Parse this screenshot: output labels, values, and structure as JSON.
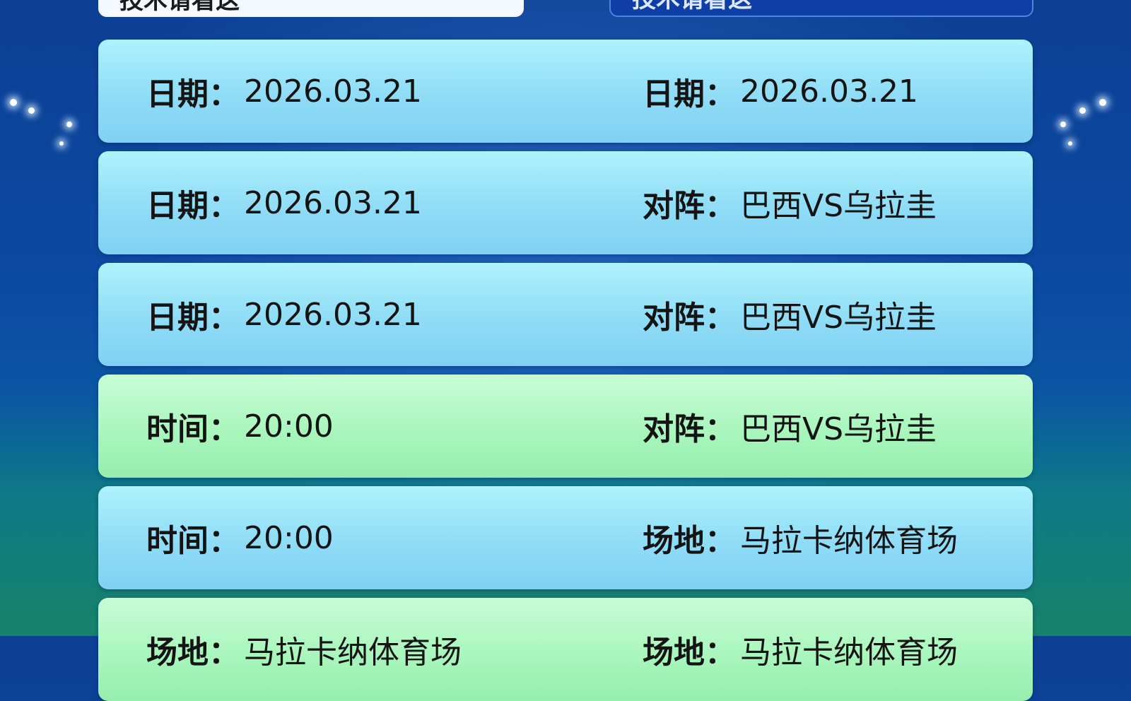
{
  "top_bars": [
    {
      "text": "技术请看这"
    },
    {
      "text": "技术请看这"
    }
  ],
  "rows": [
    {
      "bg": "blue",
      "left": {
        "label": "日期：",
        "value": "2026.03.21"
      },
      "right": {
        "label": "日期：",
        "value": "2026.03.21"
      }
    },
    {
      "bg": "blue",
      "left": {
        "label": "日期：",
        "value": "2026.03.21"
      },
      "right": {
        "label": "对阵：",
        "value": "巴西VS乌拉圭"
      }
    },
    {
      "bg": "blue",
      "left": {
        "label": "日期：",
        "value": "2026.03.21"
      },
      "right": {
        "label": "对阵：",
        "value": "巴西VS乌拉圭"
      }
    },
    {
      "bg": "green",
      "left": {
        "label": "时间：",
        "value": "20:00"
      },
      "right": {
        "label": "对阵：",
        "value": "巴西VS乌拉圭"
      }
    },
    {
      "bg": "blue",
      "left": {
        "label": "时间：",
        "value": "20:00"
      },
      "right": {
        "label": "场地：",
        "value": "马拉卡纳体育场"
      }
    },
    {
      "bg": "green",
      "left": {
        "label": "场地：",
        "value": "马拉卡纳体育场"
      },
      "right": {
        "label": "场地：",
        "value": "马拉卡纳体育场"
      }
    }
  ]
}
